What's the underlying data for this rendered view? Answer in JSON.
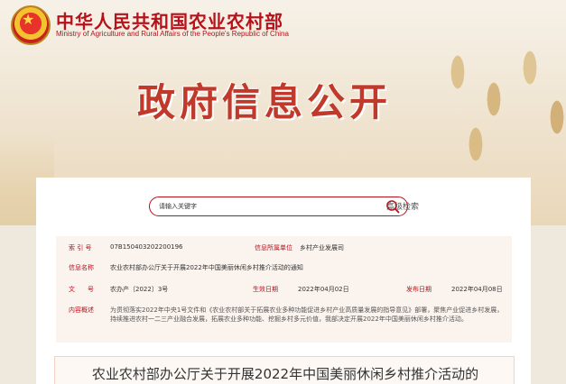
{
  "header": {
    "ministry_cn": "中华人民共和国农业农村部",
    "ministry_en": "Ministry of Agriculture and Rural Affairs of the People's Republic of China",
    "section_title": "政府信息公开",
    "emblem_icon": "national-emblem-icon"
  },
  "search": {
    "placeholder": "请输入关键字",
    "advanced_label": "高级检索",
    "icon": "search-icon"
  },
  "meta": {
    "index_label": "索 引 号",
    "index_value": "07B150403202200196",
    "owner_label": "信息所属单位",
    "owner_value": "乡村产业发展司",
    "name_label": "信息名称",
    "name_value": "农业农村部办公厅关于开展2022年中国美丽休闲乡村推介活动的通知",
    "doc_label": "文　　号",
    "doc_value": "农办产〔2022〕3号",
    "effective_label": "生效日期",
    "effective_value": "2022年04月02日",
    "publish_label": "发布日期",
    "publish_value": "2022年04月08日",
    "summary_label": "内容概述",
    "summary_value": "为贯彻落实2022年中央1号文件和《农业农村部关于拓展农业多种功能促进乡村产业高质量发展的指导意见》部署，聚焦产业促进乡村发展，持续推进农村一二三产业融合发展，拓展农业多种功能、挖掘乡村多元价值，我部决定开展2022年中国美丽休闲乡村推介活动。"
  },
  "article": {
    "title": "农业农村部办公厅关于开展2022年中国美丽休闲乡村推介活动的"
  },
  "colors": {
    "brand_red": "#b5121b",
    "title_red": "#c0392b",
    "meta_bg": "#fbf3ee"
  }
}
